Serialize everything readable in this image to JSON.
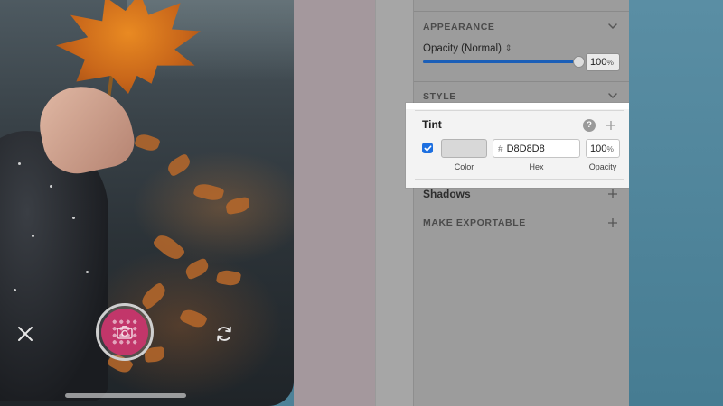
{
  "camera": {
    "close_icon": "close-icon",
    "shutter_icon": "camera-icon",
    "switch_icon": "switch-camera-icon",
    "shutter_color": "#c2366a"
  },
  "inspector": {
    "appearance": {
      "header": "APPEARANCE",
      "opacity_label": "Opacity (Normal)",
      "opacity_value": "100",
      "opacity_unit": "%",
      "slider_fraction": 1.0
    },
    "style": {
      "header": "STYLE"
    },
    "tint": {
      "title": "Tint",
      "help_label": "?",
      "enabled": true,
      "color_hex": "#D8D8D8",
      "hash": "#",
      "hex_value": "D8D8D8",
      "opacity_value": "100",
      "opacity_unit": "%",
      "caption_color": "Color",
      "caption_hex": "Hex",
      "caption_opacity": "Opacity"
    },
    "shadows": {
      "label": "Shadows"
    },
    "exportable": {
      "header": "MAKE EXPORTABLE"
    }
  },
  "colors": {
    "accent_blue": "#1d6fe0",
    "highlight_edge": "#6cc1d9",
    "backdrop": "#4d8298"
  }
}
